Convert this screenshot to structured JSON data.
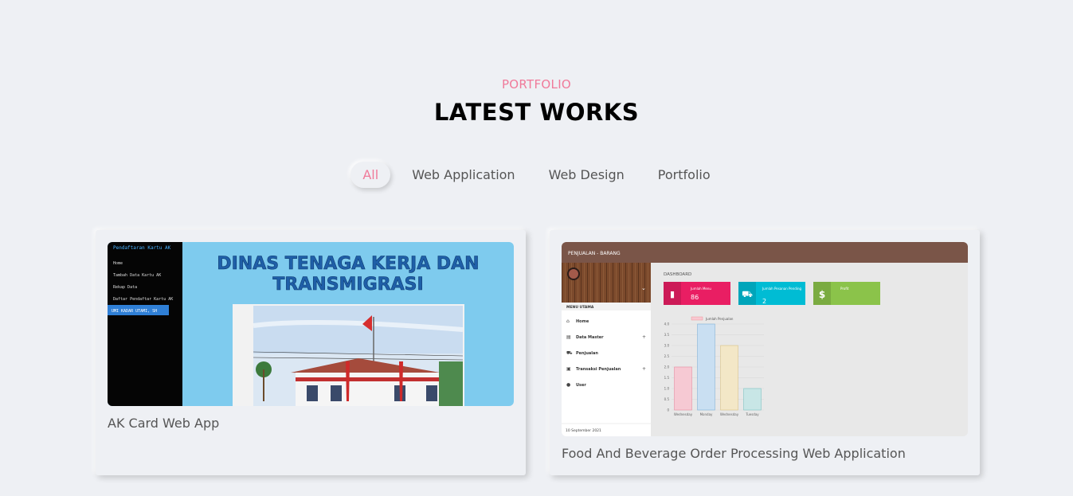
{
  "section": {
    "subtitle": "PORTFOLIO",
    "title": "LATEST WORKS"
  },
  "filters": [
    {
      "label": "All",
      "active": true
    },
    {
      "label": "Web Application",
      "active": false
    },
    {
      "label": "Web Design",
      "active": false
    },
    {
      "label": "Portfolio",
      "active": false
    }
  ],
  "works": [
    {
      "title": "AK Card Web App",
      "thumbnail": {
        "sidebar_title": "Pendaftaran Kartu AK",
        "menu": [
          "Home",
          "Tambah Data Kartu AK",
          "Rekap Data",
          "Daftar Pendaftar Kartu AK"
        ],
        "user_button": "UMI KADAR UTAMI, SH",
        "banner_line1": "DINAS TENAGA KERJA DAN",
        "banner_line2": "TRANSMIGRASI"
      }
    },
    {
      "title": "Food And Beverage Order Processing Web Application",
      "thumbnail": {
        "app_title": "PENJUALAN - BARANG",
        "menu_header": "MENU UTAMA",
        "menu": [
          "Home",
          "Data Master",
          "Penjualan",
          "Transaksi Penjualan",
          "User"
        ],
        "date": "10 September 2021",
        "dashboard_label": "DASHBOARD",
        "tiles": [
          {
            "label": "Jumlah Menu",
            "value": "86",
            "color": "#e91e63"
          },
          {
            "label": "Jumlah Pesanan Pending",
            "value": "2",
            "color": "#00bcd4"
          },
          {
            "label": "Profit",
            "value": "",
            "color": "#8bc34a"
          }
        ],
        "chart_legend": "Jumlah Penjualan",
        "chart_categories": [
          "Wednesday",
          "Monday",
          "Wednesday",
          "Tuesday"
        ],
        "chart_values": [
          2,
          4,
          3,
          1
        ],
        "chart_ticks": [
          "4.0",
          "3.5",
          "3.0",
          "2.5",
          "2.0",
          "1.5",
          "1.0",
          "0.5",
          "0"
        ]
      }
    }
  ]
}
